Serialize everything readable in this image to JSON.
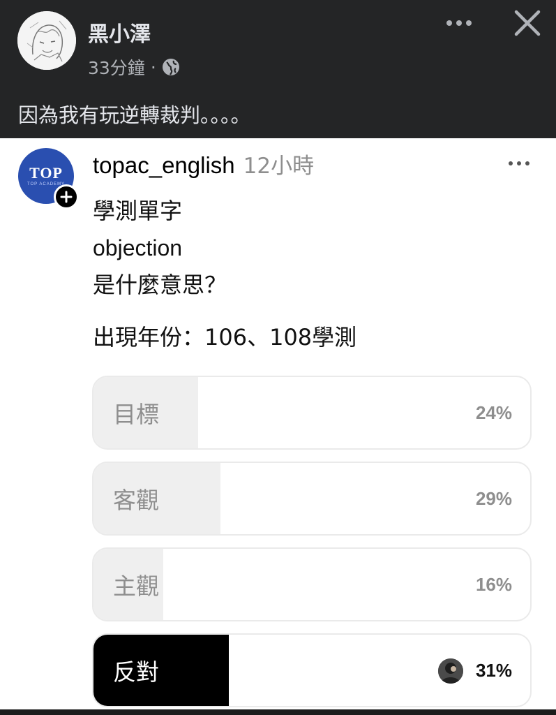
{
  "fb_post": {
    "author": "黑小澤",
    "time": "33分鐘",
    "separator": "·",
    "privacy_icon": "globe-icon",
    "text": "因為我有玩逆轉裁判。。。。"
  },
  "ig_post": {
    "username": "topac_english",
    "time": "12小時",
    "avatar_logo": "TOP",
    "avatar_subtext": "TOP ACADEMY",
    "caption_lines": [
      "學測單字",
      "objection",
      "是什麼意思？"
    ],
    "year_text": "出現年份：106、108學測"
  },
  "poll": {
    "options": [
      {
        "label": "目標",
        "percent_label": "24%",
        "percent": 24,
        "selected": false
      },
      {
        "label": "客觀",
        "percent_label": "29%",
        "percent": 29,
        "selected": false
      },
      {
        "label": "主觀",
        "percent_label": "16%",
        "percent": 16,
        "selected": false
      },
      {
        "label": "反對",
        "percent_label": "31%",
        "percent": 31,
        "selected": true
      }
    ]
  },
  "colors": {
    "fb_header_bg": "#242526",
    "ig_brand_blue": "#2a4fb0",
    "poll_fill": "#efefef",
    "poll_selected": "#000000"
  }
}
